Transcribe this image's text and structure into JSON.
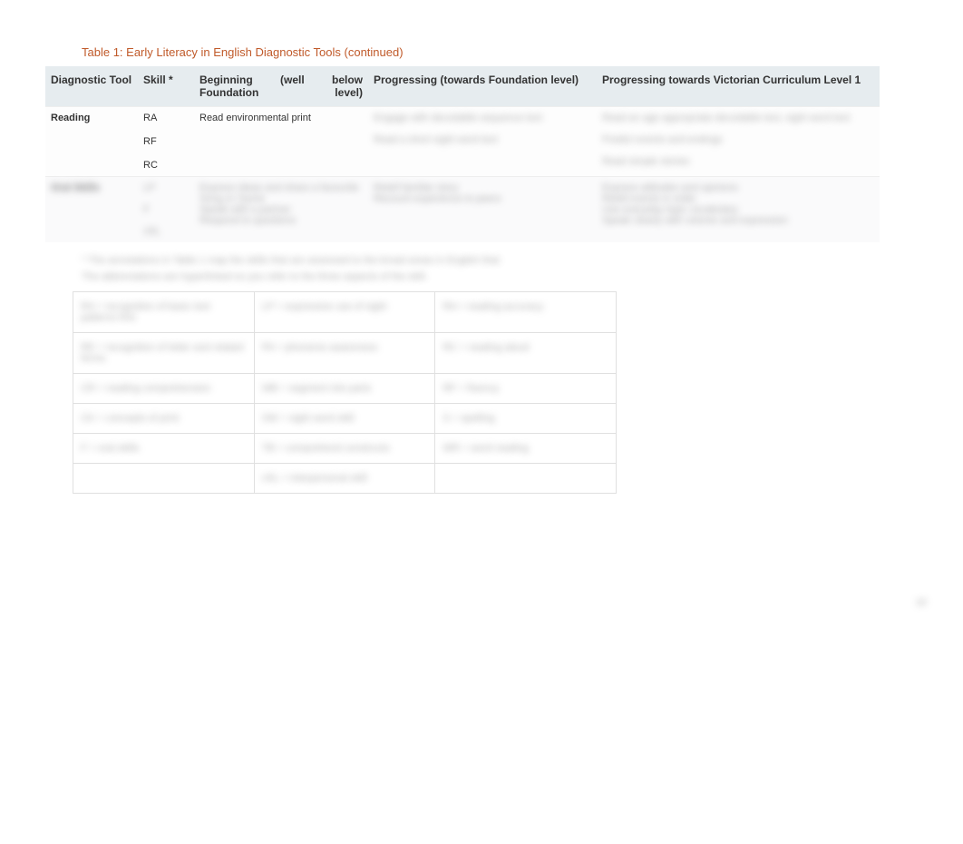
{
  "caption": "Table 1: Early Literacy in English Diagnostic Tools (continued)",
  "header": {
    "col0": "Diagnostic Tool",
    "col1": "Skill *",
    "col2": "Beginning (well below Foundation level)",
    "col3": "Progressing (towards Foundation level)",
    "col4": "Progressing towards Victorian Curriculum Level 1"
  },
  "rows": [
    {
      "tool": "Reading",
      "skills": [
        "RA",
        "RF",
        "RC"
      ],
      "beginning": "Read environmental print",
      "progressing_f": "Engage with decodable sequence text\n\nRead a short sight word text",
      "progressing_l1": "Read an age appropriate decodable text, sight word text\n\nPredict events and endings\n\nRead simple stories"
    },
    {
      "tool": "Oral Skills",
      "skills": [
        "LP",
        "F",
        "vSL"
      ],
      "beginning": "Express ideas and share a favourite\nSong or rhyme\nSpeak with a partner\nRespond to questions",
      "progressing_f": "Retell familiar story\nRecount experience to peers",
      "progressing_l1": "Express attitudes and opinions\nRetell events in order\nUse everyday topic vocabulary\nSpeak clearly with volume and expression"
    }
  ],
  "footnote": "*    The annotations in Table 1 map the skills that are assessed to the broad areas in English that:",
  "legendLead": "The abbreviations are hyperlinked so you refer to the three aspects of the skill.",
  "legend": {
    "c0r0": "RA = recognition of basic text patterns first",
    "c0r1": "RE = recognition of letter and related forms",
    "c0r2": "CR = reading comprehension",
    "c0r3": "CK = concepts of print",
    "c0r4": "F = oral skills",
    "c1r0": "LP = expressive use of sight",
    "c1r1": "PA = phoneme awareness",
    "c1r2": "WB = segment into parts",
    "c1r3": "SW = sight word skill",
    "c1r4": "TB = comprehend constructs",
    "c1r5": "vSL = interpersonal skill",
    "c2r0": "RA = reading accuracy",
    "c2r1": "RC = reading aloud",
    "c2r2": "RF = fluency",
    "c2r3": "S = spelling",
    "c2r4": "WR = word reading"
  },
  "pageNumber": "10"
}
